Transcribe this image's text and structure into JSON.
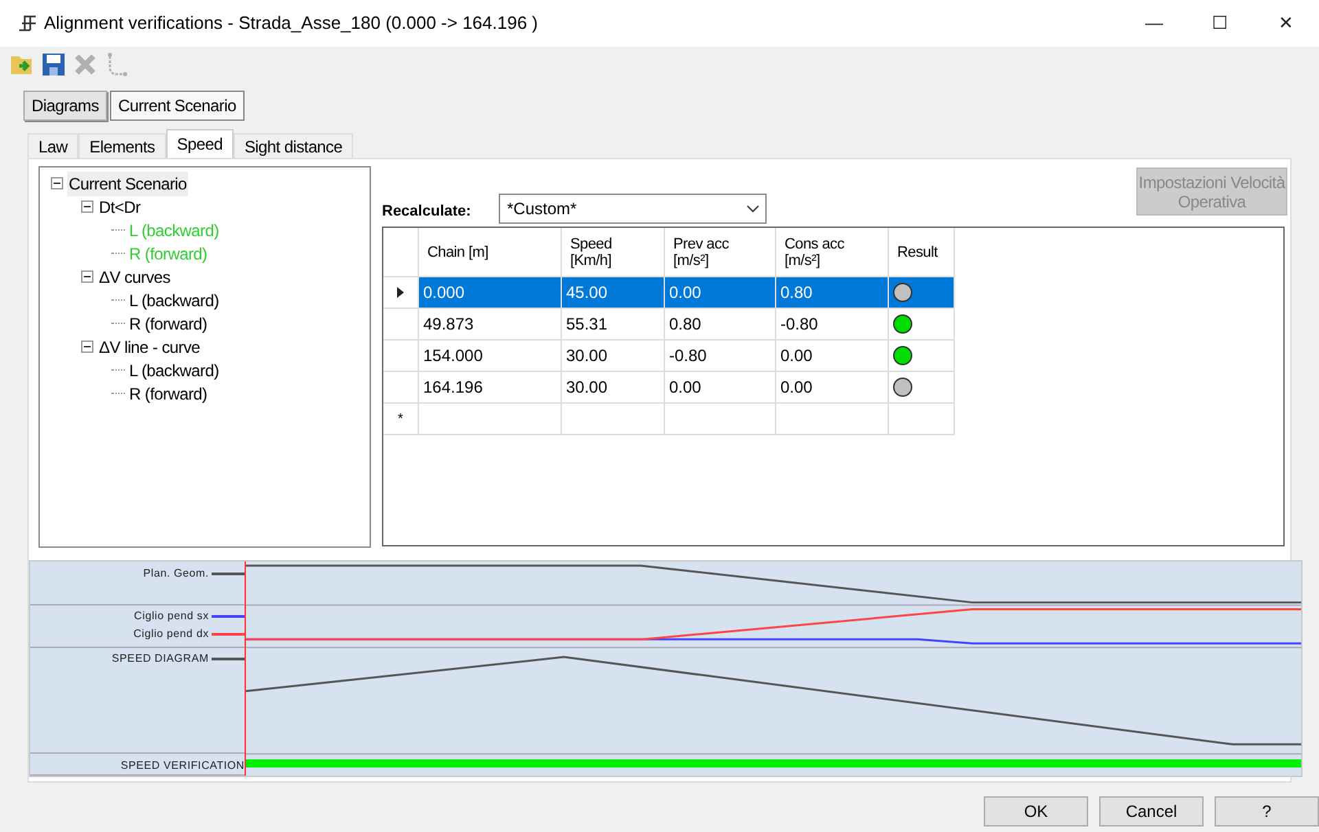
{
  "window": {
    "title": "Alignment verifications - Strada_Asse_180 (0.000 -> 164.196 )",
    "controls": [
      "—",
      "☐",
      "✕"
    ]
  },
  "toolbar": [
    {
      "kind": "open",
      "disabled": false
    },
    {
      "kind": "save",
      "disabled": false
    },
    {
      "kind": "delete",
      "disabled": true
    },
    {
      "kind": "route",
      "disabled": true
    }
  ],
  "outer_tabs": [
    {
      "label": "Diagrams",
      "selected": false
    },
    {
      "label": "Current Scenario",
      "selected": true
    }
  ],
  "inner_tabs": [
    {
      "label": "Law",
      "selected": false
    },
    {
      "label": "Elements",
      "selected": false
    },
    {
      "label": "Speed",
      "selected": true
    },
    {
      "label": "Sight distance",
      "selected": false
    }
  ],
  "tree": {
    "label": "Current Scenario",
    "expanded": true,
    "color": "#000000",
    "children": [
      {
        "label": "Dt<Dr",
        "expanded": true,
        "color": "#000000",
        "children": [
          {
            "label": "L (backward)",
            "color": "#33cc33"
          },
          {
            "label": "R (forward)",
            "color": "#33cc33"
          }
        ]
      },
      {
        "label": "ΔV curves",
        "expanded": true,
        "color": "#000000",
        "children": [
          {
            "label": "L (backward)",
            "color": "#000000"
          },
          {
            "label": "R (forward)",
            "color": "#000000"
          }
        ]
      },
      {
        "label": "ΔV line - curve",
        "expanded": true,
        "color": "#000000",
        "children": [
          {
            "label": "L (backward)",
            "color": "#000000"
          },
          {
            "label": "R (forward)",
            "color": "#000000"
          }
        ]
      }
    ]
  },
  "recalculate": {
    "label": "Recalculate:",
    "value": "*Custom*"
  },
  "settings_button": {
    "label": "Impostazioni Velocità Operativa",
    "disabled": true
  },
  "table": {
    "columns": [
      "Chain [m]",
      "Speed [Km/h]",
      "Prev acc [m/s²]",
      "Cons acc [m/s²]",
      "Result"
    ],
    "rows": [
      {
        "cells": [
          "0.000",
          "45.00",
          "0.00",
          "0.80"
        ],
        "color": "#c0c0c0",
        "selected": true
      },
      {
        "cells": [
          "49.873",
          "55.31",
          "0.80",
          "-0.80"
        ],
        "color": "#00dd00",
        "selected": false
      },
      {
        "cells": [
          "154.000",
          "30.00",
          "-0.80",
          "0.00"
        ],
        "color": "#00dd00",
        "selected": false
      },
      {
        "cells": [
          "164.196",
          "30.00",
          "0.00",
          "0.00"
        ],
        "color": "#c0c0c0",
        "selected": false
      }
    ],
    "new_row_marker": "*"
  },
  "diagram": {
    "tracks": [
      {
        "label": "Plan. Geom.",
        "color": "#555555"
      },
      {
        "label": "Ciglio pend sx",
        "color": "#4444ff"
      },
      {
        "label": "Ciglio pend dx",
        "color": "#ff4444"
      },
      {
        "label": "SPEED DIAGRAM",
        "color": "#555555"
      },
      {
        "label": "SPEED VERIFICATION",
        "color": "#00ee00"
      }
    ]
  },
  "buttons": [
    "OK",
    "Cancel",
    "?"
  ]
}
